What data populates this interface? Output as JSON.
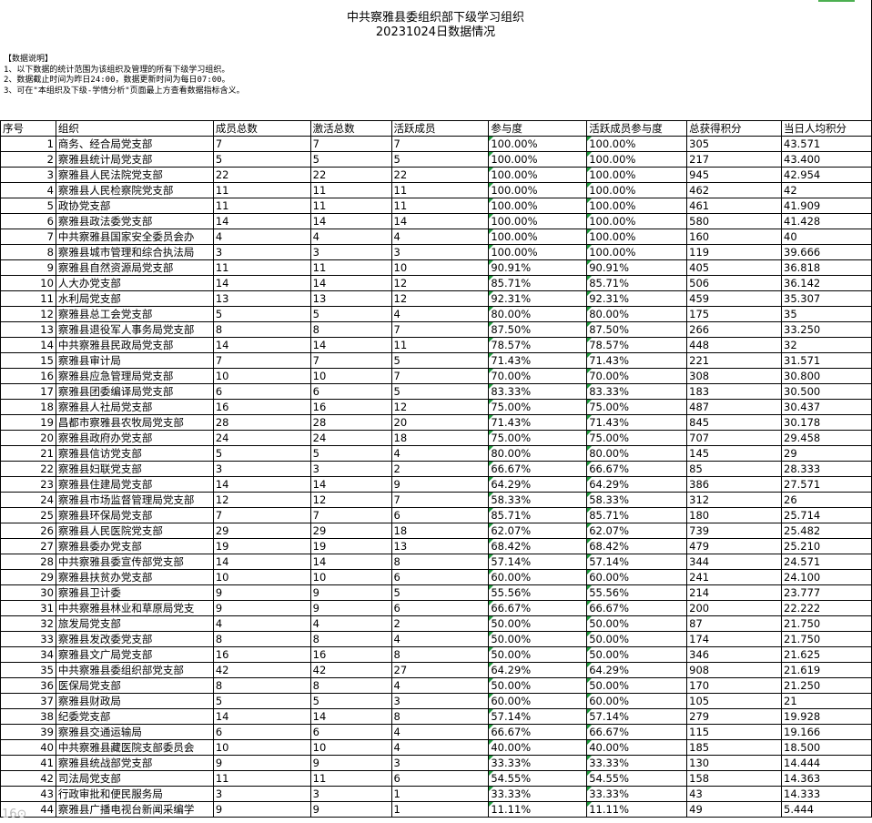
{
  "title": "中共察雅县委组织部下级学习组织",
  "subtitle": "20231024日数据情况",
  "notes": [
    "【数据说明】",
    "1、以下数据的统计范围为该组织及管理的所有下级学习组织。",
    "2、数据截止时间为昨日24:00，数据更新时间为每日07:00。",
    "3、可在\"本组织及下级-学情分析\"页面最上方查看数据指标含义。"
  ],
  "headers": [
    "序号",
    "组织",
    "成员总数",
    "激活总数",
    "活跃成员",
    "参与度",
    "活跃成员参与度",
    "总获得积分",
    "当日人均积分"
  ],
  "rows": [
    [
      "1",
      "商务、经合局党支部",
      "7",
      "7",
      "7",
      "100.00%",
      "100.00%",
      "305",
      "43.571"
    ],
    [
      "2",
      "察雅县统计局党支部",
      "5",
      "5",
      "5",
      "100.00%",
      "100.00%",
      "217",
      "43.400"
    ],
    [
      "3",
      "察雅县人民法院党支部",
      "22",
      "22",
      "22",
      "100.00%",
      "100.00%",
      "945",
      "42.954"
    ],
    [
      "4",
      "察雅县人民检察院党支部",
      "11",
      "11",
      "11",
      "100.00%",
      "100.00%",
      "462",
      "42"
    ],
    [
      "5",
      "政协党支部",
      "11",
      "11",
      "11",
      "100.00%",
      "100.00%",
      "461",
      "41.909"
    ],
    [
      "6",
      "察雅县政法委党支部",
      "14",
      "14",
      "14",
      "100.00%",
      "100.00%",
      "580",
      "41.428"
    ],
    [
      "7",
      "中共察雅县国家安全委员会办",
      "4",
      "4",
      "4",
      "100.00%",
      "100.00%",
      "160",
      "40"
    ],
    [
      "8",
      "察雅县城市管理和综合执法局",
      "3",
      "3",
      "3",
      "100.00%",
      "100.00%",
      "119",
      "39.666"
    ],
    [
      "9",
      "察雅县自然资源局党支部",
      "11",
      "11",
      "10",
      "90.91%",
      "90.91%",
      "405",
      "36.818"
    ],
    [
      "10",
      "人大办党支部",
      "14",
      "14",
      "12",
      "85.71%",
      "85.71%",
      "506",
      "36.142"
    ],
    [
      "11",
      "水利局党支部",
      "13",
      "13",
      "12",
      "92.31%",
      "92.31%",
      "459",
      "35.307"
    ],
    [
      "12",
      "察雅县总工会党支部",
      "5",
      "5",
      "4",
      "80.00%",
      "80.00%",
      "175",
      "35"
    ],
    [
      "13",
      "察雅县退役军人事务局党支部",
      "8",
      "8",
      "7",
      "87.50%",
      "87.50%",
      "266",
      "33.250"
    ],
    [
      "14",
      "中共察雅县民政局党支部",
      "14",
      "14",
      "11",
      "78.57%",
      "78.57%",
      "448",
      "32"
    ],
    [
      "15",
      "察雅县审计局",
      "7",
      "7",
      "5",
      "71.43%",
      "71.43%",
      "221",
      "31.571"
    ],
    [
      "16",
      "察雅县应急管理局党支部",
      "10",
      "10",
      "7",
      "70.00%",
      "70.00%",
      "308",
      "30.800"
    ],
    [
      "17",
      "察雅县团委编译局党支部",
      "6",
      "6",
      "5",
      "83.33%",
      "83.33%",
      "183",
      "30.500"
    ],
    [
      "18",
      "察雅县人社局党支部",
      "16",
      "16",
      "12",
      "75.00%",
      "75.00%",
      "487",
      "30.437"
    ],
    [
      "19",
      "昌都市察雅县农牧局党支部",
      "28",
      "28",
      "20",
      "71.43%",
      "71.43%",
      "845",
      "30.178"
    ],
    [
      "20",
      "察雅县政府办党支部",
      "24",
      "24",
      "18",
      "75.00%",
      "75.00%",
      "707",
      "29.458"
    ],
    [
      "21",
      "察雅县信访党支部",
      "5",
      "5",
      "4",
      "80.00%",
      "80.00%",
      "145",
      "29"
    ],
    [
      "22",
      "察雅县妇联党支部",
      "3",
      "3",
      "2",
      "66.67%",
      "66.67%",
      "85",
      "28.333"
    ],
    [
      "23",
      "察雅县住建局党支部",
      "14",
      "14",
      "9",
      "64.29%",
      "64.29%",
      "386",
      "27.571"
    ],
    [
      "24",
      "察雅县市场监督管理局党支部",
      "12",
      "12",
      "7",
      "58.33%",
      "58.33%",
      "312",
      "26"
    ],
    [
      "25",
      "察雅县环保局党支部",
      "7",
      "7",
      "6",
      "85.71%",
      "85.71%",
      "180",
      "25.714"
    ],
    [
      "26",
      "察雅县人民医院党支部",
      "29",
      "29",
      "18",
      "62.07%",
      "62.07%",
      "739",
      "25.482"
    ],
    [
      "27",
      "察雅县委办党支部",
      "19",
      "19",
      "13",
      "68.42%",
      "68.42%",
      "479",
      "25.210"
    ],
    [
      "28",
      "中共察雅县委宣传部党支部",
      "14",
      "14",
      "8",
      "57.14%",
      "57.14%",
      "344",
      "24.571"
    ],
    [
      "29",
      "察雅县扶贫办党支部",
      "10",
      "10",
      "6",
      "60.00%",
      "60.00%",
      "241",
      "24.100"
    ],
    [
      "30",
      "察雅县卫计委",
      "9",
      "9",
      "5",
      "55.56%",
      "55.56%",
      "214",
      "23.777"
    ],
    [
      "31",
      "中共察雅县林业和草原局党支",
      "9",
      "9",
      "6",
      "66.67%",
      "66.67%",
      "200",
      "22.222"
    ],
    [
      "32",
      "旅发局党支部",
      "4",
      "4",
      "2",
      "50.00%",
      "50.00%",
      "87",
      "21.750"
    ],
    [
      "33",
      "察雅县发改委党支部",
      "8",
      "8",
      "4",
      "50.00%",
      "50.00%",
      "174",
      "21.750"
    ],
    [
      "34",
      "察雅县文广局党支部",
      "16",
      "16",
      "8",
      "50.00%",
      "50.00%",
      "346",
      "21.625"
    ],
    [
      "35",
      "中共察雅县委组织部党支部",
      "42",
      "42",
      "27",
      "64.29%",
      "64.29%",
      "908",
      "21.619"
    ],
    [
      "36",
      "医保局党支部",
      "8",
      "8",
      "4",
      "50.00%",
      "50.00%",
      "170",
      "21.250"
    ],
    [
      "37",
      "察雅县财政局",
      "5",
      "5",
      "3",
      "60.00%",
      "60.00%",
      "105",
      "21"
    ],
    [
      "38",
      "纪委党支部",
      "14",
      "14",
      "8",
      "57.14%",
      "57.14%",
      "279",
      "19.928"
    ],
    [
      "39",
      "察雅县交通运输局",
      "6",
      "6",
      "4",
      "66.67%",
      "66.67%",
      "115",
      "19.166"
    ],
    [
      "40",
      "中共察雅县藏医院支部委员会",
      "10",
      "10",
      "4",
      "40.00%",
      "40.00%",
      "185",
      "18.500"
    ],
    [
      "41",
      "察雅县统战部党支部",
      "9",
      "9",
      "3",
      "33.33%",
      "33.33%",
      "130",
      "14.444"
    ],
    [
      "42",
      "司法局党支部",
      "11",
      "11",
      "6",
      "54.55%",
      "54.55%",
      "158",
      "14.363"
    ],
    [
      "43",
      "行政审批和便民服务局",
      "3",
      "3",
      "1",
      "33.33%",
      "33.33%",
      "43",
      "14.333"
    ],
    [
      "44",
      "察雅县广播电视台新闻采编学",
      "9",
      "9",
      "1",
      "11.11%",
      "11.11%",
      "49",
      "5.444"
    ]
  ],
  "watermark": "16⊙"
}
